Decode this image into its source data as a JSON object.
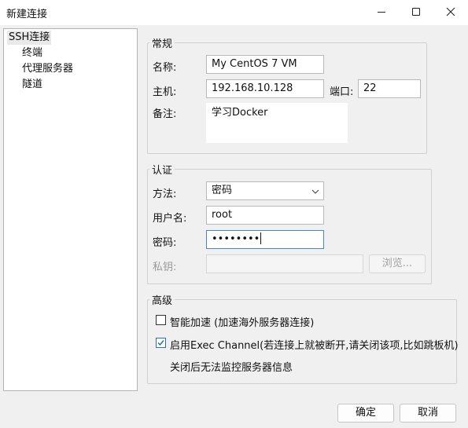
{
  "window": {
    "title": "新建连接",
    "controls": {
      "minimize": "minimize-icon",
      "maximize": "maximize-icon",
      "close": "close-icon"
    }
  },
  "tree": {
    "root": "SSH连接",
    "children": [
      "终端",
      "代理服务器",
      "隧道"
    ]
  },
  "general": {
    "title": "常规",
    "name_label": "名称:",
    "name_value": "My CentOS 7 VM",
    "host_label": "主机:",
    "host_value": "192.168.10.128",
    "port_label": "端口:",
    "port_value": "22",
    "note_label": "备注:",
    "note_value": "学习Docker"
  },
  "auth": {
    "title": "认证",
    "method_label": "方法:",
    "method_value": "密码",
    "user_label": "用户名:",
    "user_value": "root",
    "password_label": "密码:",
    "password_value": "••••••••",
    "key_label": "私钥:",
    "browse_label": "浏览..."
  },
  "advanced": {
    "title": "高级",
    "smart_accel_label": "智能加速 (加速海外服务器连接)",
    "smart_accel_checked": false,
    "exec_channel_label": "启用Exec Channel(若连接上就被断开,请关闭该项,比如跳板机)",
    "exec_channel_checked": true,
    "exec_channel_note": "关闭后无法监控服务器信息"
  },
  "footer": {
    "ok_label": "确定",
    "cancel_label": "取消"
  },
  "colors": {
    "focus_border": "#3c8ad6",
    "check_mark": "#2a6fb8"
  }
}
